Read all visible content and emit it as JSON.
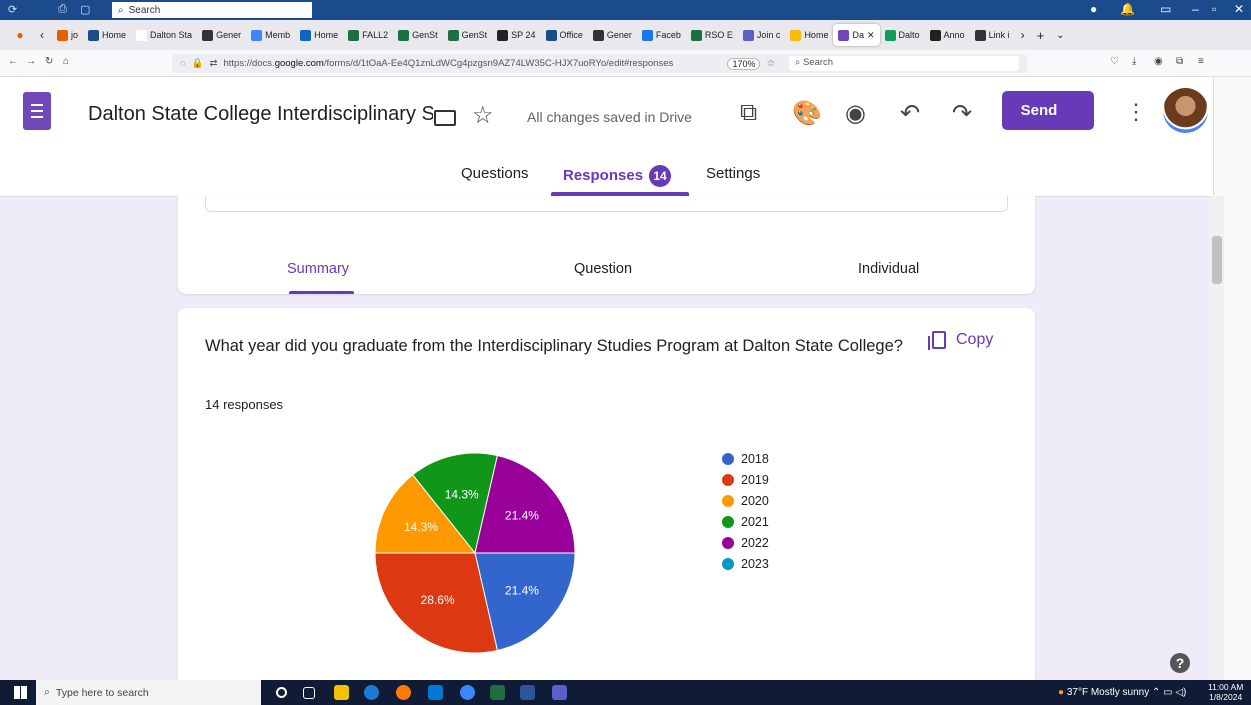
{
  "window": {
    "search_placeholder": "Search"
  },
  "tabs": [
    {
      "label": "jo",
      "color": "#e66000"
    },
    {
      "label": "Home",
      "color": "#1b4b8c"
    },
    {
      "label": "Dalton Sta",
      "color": "#ffffff"
    },
    {
      "label": "Gener",
      "color": "#333333"
    },
    {
      "label": "Memb",
      "color": "#4285f4"
    },
    {
      "label": "Home",
      "color": "#0a66c2"
    },
    {
      "label": "FALL2",
      "color": "#1d6f42"
    },
    {
      "label": "GenSt",
      "color": "#1d6f42"
    },
    {
      "label": "GenSt",
      "color": "#1d6f42"
    },
    {
      "label": "SP 24",
      "color": "#222222"
    },
    {
      "label": "Office",
      "color": "#1b4b8c"
    },
    {
      "label": "Gener",
      "color": "#333333"
    },
    {
      "label": "Faceb",
      "color": "#1877f2"
    },
    {
      "label": "RSO E",
      "color": "#1d6f42"
    },
    {
      "label": "Join c",
      "color": "#5b5fc7"
    },
    {
      "label": "Home",
      "color": "#fbbc04"
    },
    {
      "label": "Da",
      "color": "#7248b9",
      "active": true
    },
    {
      "label": "Dalto",
      "color": "#0f9d58"
    },
    {
      "label": "Anno",
      "color": "#222222"
    },
    {
      "label": "Link i",
      "color": "#333333"
    }
  ],
  "browser": {
    "url_prefix": "https://docs.",
    "url_domain": "google.com",
    "url_suffix": "/forms/d/1tOaA-Ee4Q1znLdWCg4pzgsn9AZ74LW35C-HJX7uoRYo/edit#responses",
    "zoom": "170%",
    "search_placeholder": "Search"
  },
  "form": {
    "title": "Dalton State College Interdisciplinary Studies",
    "save_status": "All changes saved in Drive",
    "send_label": "Send",
    "tabs": {
      "questions": "Questions",
      "responses": "Responses",
      "responses_count": "14",
      "settings": "Settings"
    },
    "subtabs": {
      "summary": "Summary",
      "question": "Question",
      "individual": "Individual"
    },
    "question_text": "What year did you graduate from the Interdisciplinary Studies Program at Dalton State College?",
    "response_count_text": "14 responses",
    "copy_label": "Copy"
  },
  "chart_data": {
    "type": "pie",
    "categories": [
      "2018",
      "2019",
      "2020",
      "2021",
      "2022",
      "2023"
    ],
    "values": [
      21.4,
      28.6,
      14.3,
      14.3,
      21.4,
      0
    ],
    "labels": [
      "21.4%",
      "28.6%",
      "14.3%",
      "14.3%",
      "21.4%",
      ""
    ],
    "colors": [
      "#3366cc",
      "#dc3912",
      "#ff9900",
      "#109618",
      "#990099",
      "#0099c6"
    ],
    "legend_position": "right"
  },
  "taskbar": {
    "search_placeholder": "Type here to search",
    "weather": "37°F  Mostly sunny",
    "time": "11:00 AM",
    "date": "1/8/2024"
  }
}
